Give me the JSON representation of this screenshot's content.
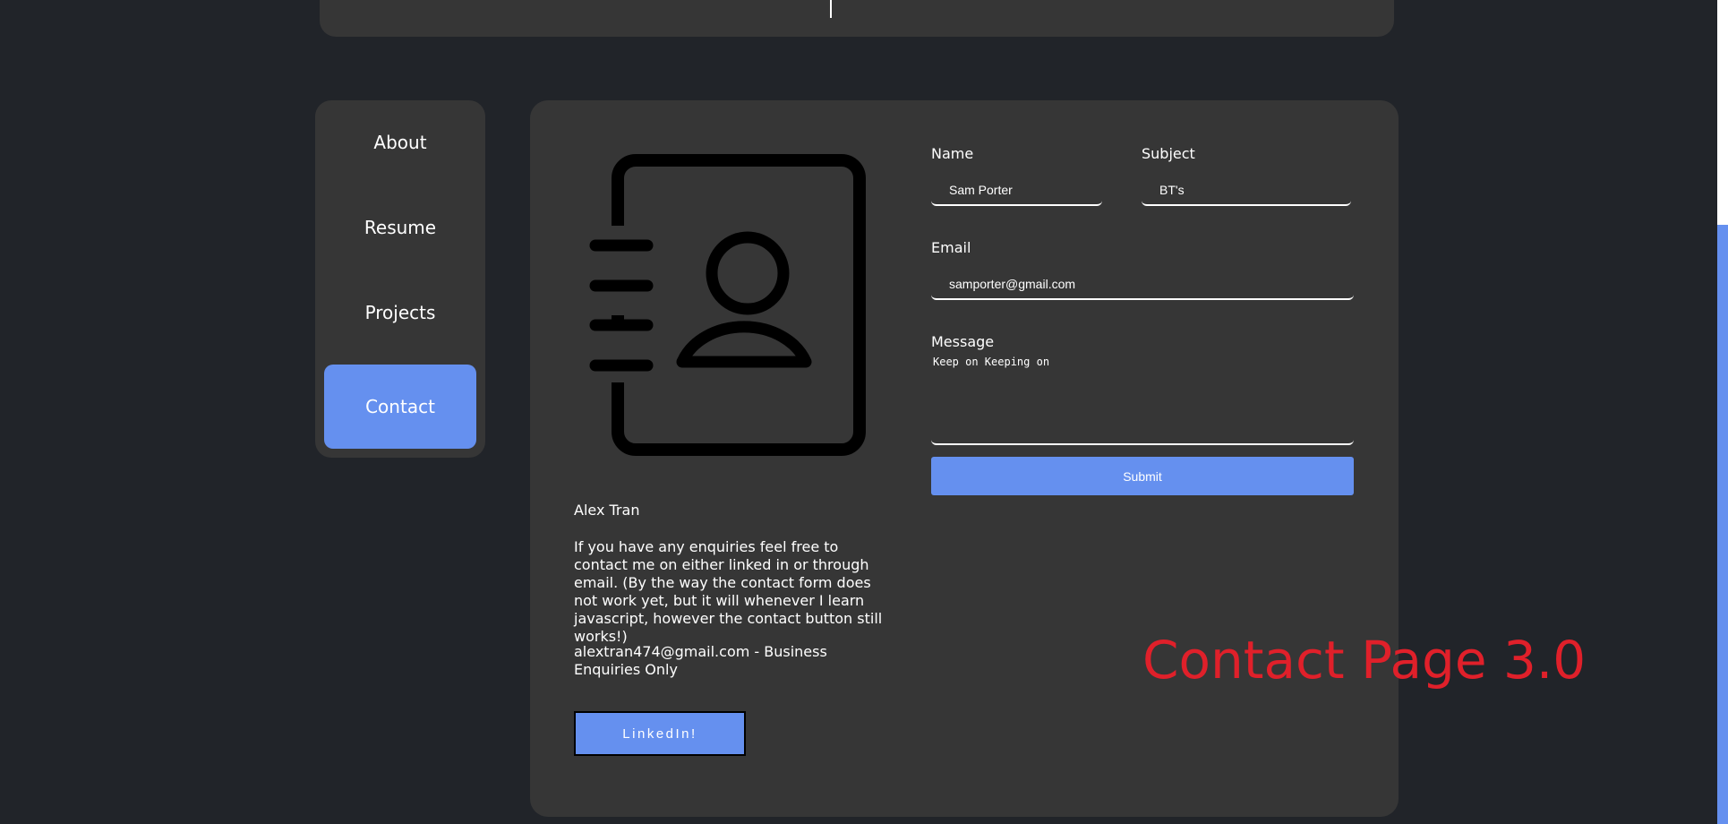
{
  "nav": {
    "items": [
      {
        "label": "About",
        "active": false
      },
      {
        "label": "Resume",
        "active": false
      },
      {
        "label": "Projects",
        "active": false
      },
      {
        "label": "Contact",
        "active": true
      }
    ]
  },
  "contact_info": {
    "icon": "contact-book-icon",
    "name": "Alex Tran",
    "description": "If you have any enquiries feel free to contact me on either linked in or through email. (By the way the contact form does not work yet, but it will whenever I learn javascript, however the contact button still works!)",
    "email_line": "alextran474@gmail.com - Business Enquiries Only",
    "linkedin_label": "LinkedIn!"
  },
  "form": {
    "name": {
      "label": "Name",
      "value": "Sam Porter"
    },
    "subject": {
      "label": "Subject",
      "value": "BT's"
    },
    "email": {
      "label": "Email",
      "value": "samporter@gmail.com"
    },
    "message": {
      "label": "Message",
      "value": "Keep on Keeping on"
    },
    "submit_label": "Submit"
  },
  "overlay": {
    "text": "Contact Page 3.0",
    "color": "#e0202a"
  },
  "colors": {
    "background": "#212429",
    "card": "#363636",
    "accent": "#6590ef"
  }
}
